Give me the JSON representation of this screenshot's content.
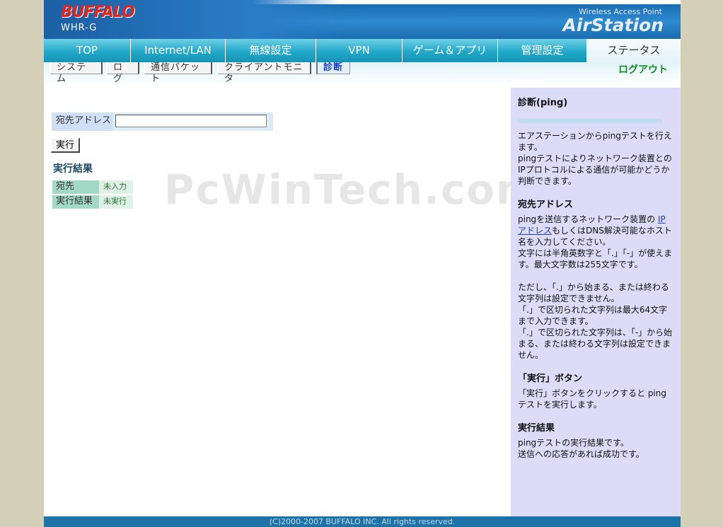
{
  "header": {
    "brand": "BUFFALO",
    "model": "WHR-G",
    "product_line": "Wireless Access Point",
    "product_name": "AirStation"
  },
  "nav": {
    "tabs": [
      {
        "label": "TOP"
      },
      {
        "label": "Internet/LAN"
      },
      {
        "label": "無線設定"
      },
      {
        "label": "VPN"
      },
      {
        "label": "ゲーム＆アプリ"
      },
      {
        "label": "管理設定"
      },
      {
        "label": "ステータス",
        "active": true
      }
    ]
  },
  "subnav": {
    "tabs": [
      {
        "label": "システム"
      },
      {
        "label": "ログ"
      },
      {
        "label": "通信パケット"
      },
      {
        "label": "クライアントモニタ"
      },
      {
        "label": "診断",
        "active": true
      }
    ],
    "logout": "ログアウト"
  },
  "main": {
    "dest_label": "宛先アドレス",
    "dest_value": "",
    "exec_button": "実行",
    "result_heading": "実行結果",
    "results": [
      {
        "label": "宛先",
        "value": "未入力"
      },
      {
        "label": "実行結果",
        "value": "未実行"
      }
    ],
    "watermark": "PcWinTech.com"
  },
  "help": {
    "title": "診断(ping)",
    "intro": "エアステーションからpingテストを行えます。\npingテストによりネットワーク装置とのIPプロトコルによる通信が可能かどうか判断できます。",
    "dest_heading": "宛先アドレス",
    "dest_text_before_link": "pingを送信するネットワーク装置の ",
    "dest_link": "IPアドレス",
    "dest_text_after_link": "もしくはDNS解決可能なホスト名を入力してください。\n文字には半角英数字と「.」「-」が使えます。最大文字数は255文字です。\n\nただし、「.」から始まる、または終わる文字列は設定できません。\n「.」で区切られた文字列は最大64文字まで入力できます。\n「.」で区切られた文字列は、「-」から始まる、または終わる文字列は設定できません。",
    "exec_heading": "「実行」ボタン",
    "exec_text": "「実行」ボタンをクリックすると pingテストを実行します。",
    "result_heading": "実行結果",
    "result_text": "pingテストの実行結果です。\n送信への応答があれば成功です。"
  },
  "footer": {
    "copyright": "(C)2000-2007 BUFFALO INC. All rights reserved."
  },
  "colors": {
    "brand_red": "#e5231b",
    "nav_teal": "#22a8c8",
    "logout_green": "#0f8f24",
    "help_bg": "#dcdcf8",
    "footer_blue": "#1d72a8"
  }
}
